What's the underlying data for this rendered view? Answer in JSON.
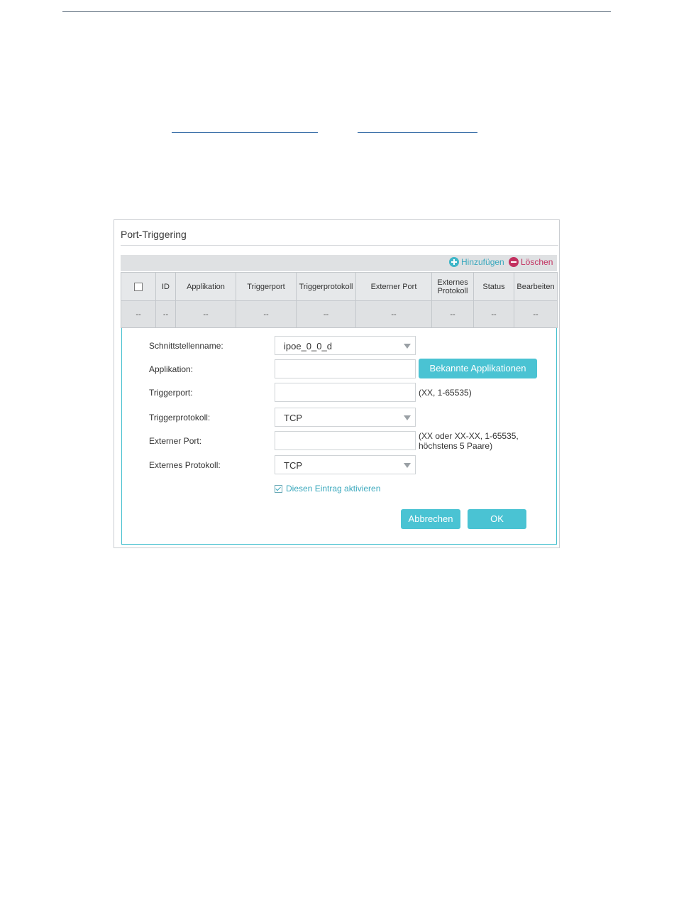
{
  "panel": {
    "title": "Port-Triggering",
    "toolbar": {
      "add_label": "Hinzufügen",
      "delete_label": "Löschen"
    },
    "table": {
      "columns": [
        "ID",
        "Applikation",
        "Triggerport",
        "Triggerprotokoll",
        "Externer Port",
        "Externes Protokoll",
        "Status",
        "Bearbeiten"
      ],
      "rows": [
        [
          "--",
          "--",
          "--",
          "--",
          "--",
          "--",
          "--",
          "--",
          "--"
        ]
      ]
    },
    "form": {
      "interface_label": "Schnittstellenname:",
      "interface_value": "ipoe_0_0_d",
      "application_label": "Applikation:",
      "application_value": "",
      "known_apps_button": "Bekannte Applikationen",
      "triggerport_label": "Triggerport:",
      "triggerport_value": "",
      "triggerport_hint": "(XX, 1-65535)",
      "triggerprotocol_label": "Triggerprotokoll:",
      "triggerprotocol_value": "TCP",
      "external_port_label": "Externer Port:",
      "external_port_value": "",
      "external_port_hint_1": "(XX oder XX-XX, 1-65535,",
      "external_port_hint_2": "höchstens 5 Paare)",
      "external_protocol_label": "Externes Protokoll:",
      "external_protocol_value": "TCP",
      "enable_label": "Diesen Eintrag aktivieren",
      "enable_checked": true,
      "cancel_button": "Abbrechen",
      "ok_button": "OK"
    }
  },
  "colors": {
    "accent": "#4ac3d3",
    "delete": "#c2305f"
  }
}
